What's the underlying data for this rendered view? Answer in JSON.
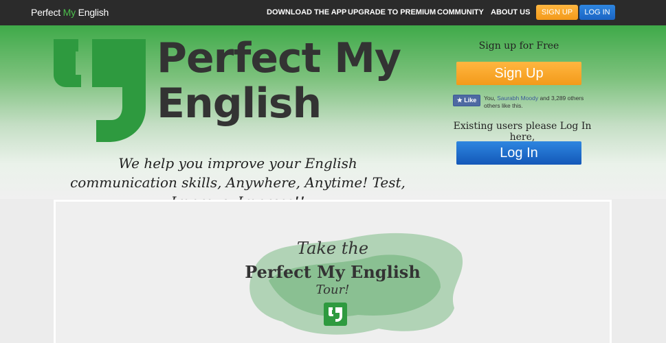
{
  "nav": {
    "brand_pre": "Perfect ",
    "brand_my": "My",
    "brand_post": " English",
    "links": [
      "DOWNLOAD THE APP",
      "UPGRADE TO PREMIUM",
      "COMMUNITY",
      "ABOUT US"
    ],
    "signup": "SIGN UP",
    "login": "LOG IN"
  },
  "hero": {
    "title_line1": "Perfect My",
    "title_line2": "English",
    "tagline": "We help you improve your English communication skills, Anywhere, Anytime! Test, Improve, Impress!!"
  },
  "auth": {
    "signup_heading": "Sign up for Free",
    "signup_button": "Sign Up",
    "fb_like": "Like",
    "fb_prefix": "You, ",
    "fb_name": "Saurabh Moody",
    "fb_suffix": " and 3,289 others others like this.",
    "existing_text": "Existing users please Log In here,",
    "login_button": "Log In"
  },
  "tour": {
    "take": "Take the",
    "title": "Perfect My English",
    "word": "Tour!"
  },
  "colors": {
    "green": "#3faa49",
    "orange": "#f7a42c",
    "blue": "#1a64c4",
    "dark": "#2b2b2b"
  },
  "icons": {
    "logo": "quote-mark-icon",
    "tour": "quote-mark-icon"
  }
}
